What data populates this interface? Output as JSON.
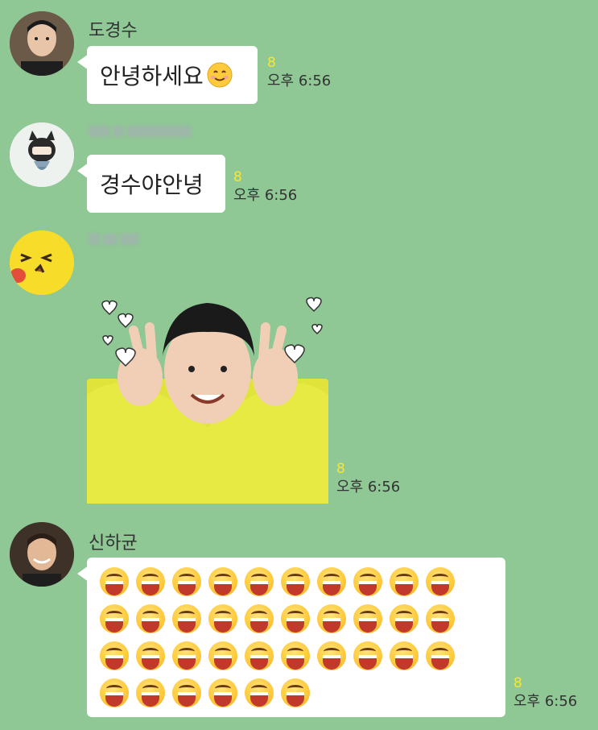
{
  "messages": [
    {
      "sender": "도경수",
      "text": "안녕하세요",
      "unread": "8",
      "time": "오후 6:56"
    },
    {
      "sender": "",
      "text": "경수야안녕",
      "unread": "8",
      "time": "오후 6:56"
    },
    {
      "sender": "",
      "sticker": "sticker-image",
      "unread": "8",
      "time": "오후 6:56"
    },
    {
      "sender": "신하균",
      "emoji_count": 36,
      "unread": "8",
      "time": "오후 6:56"
    }
  ],
  "colors": {
    "background": "#8fc795",
    "bubble": "#ffffff",
    "unread": "#f5e63a"
  }
}
